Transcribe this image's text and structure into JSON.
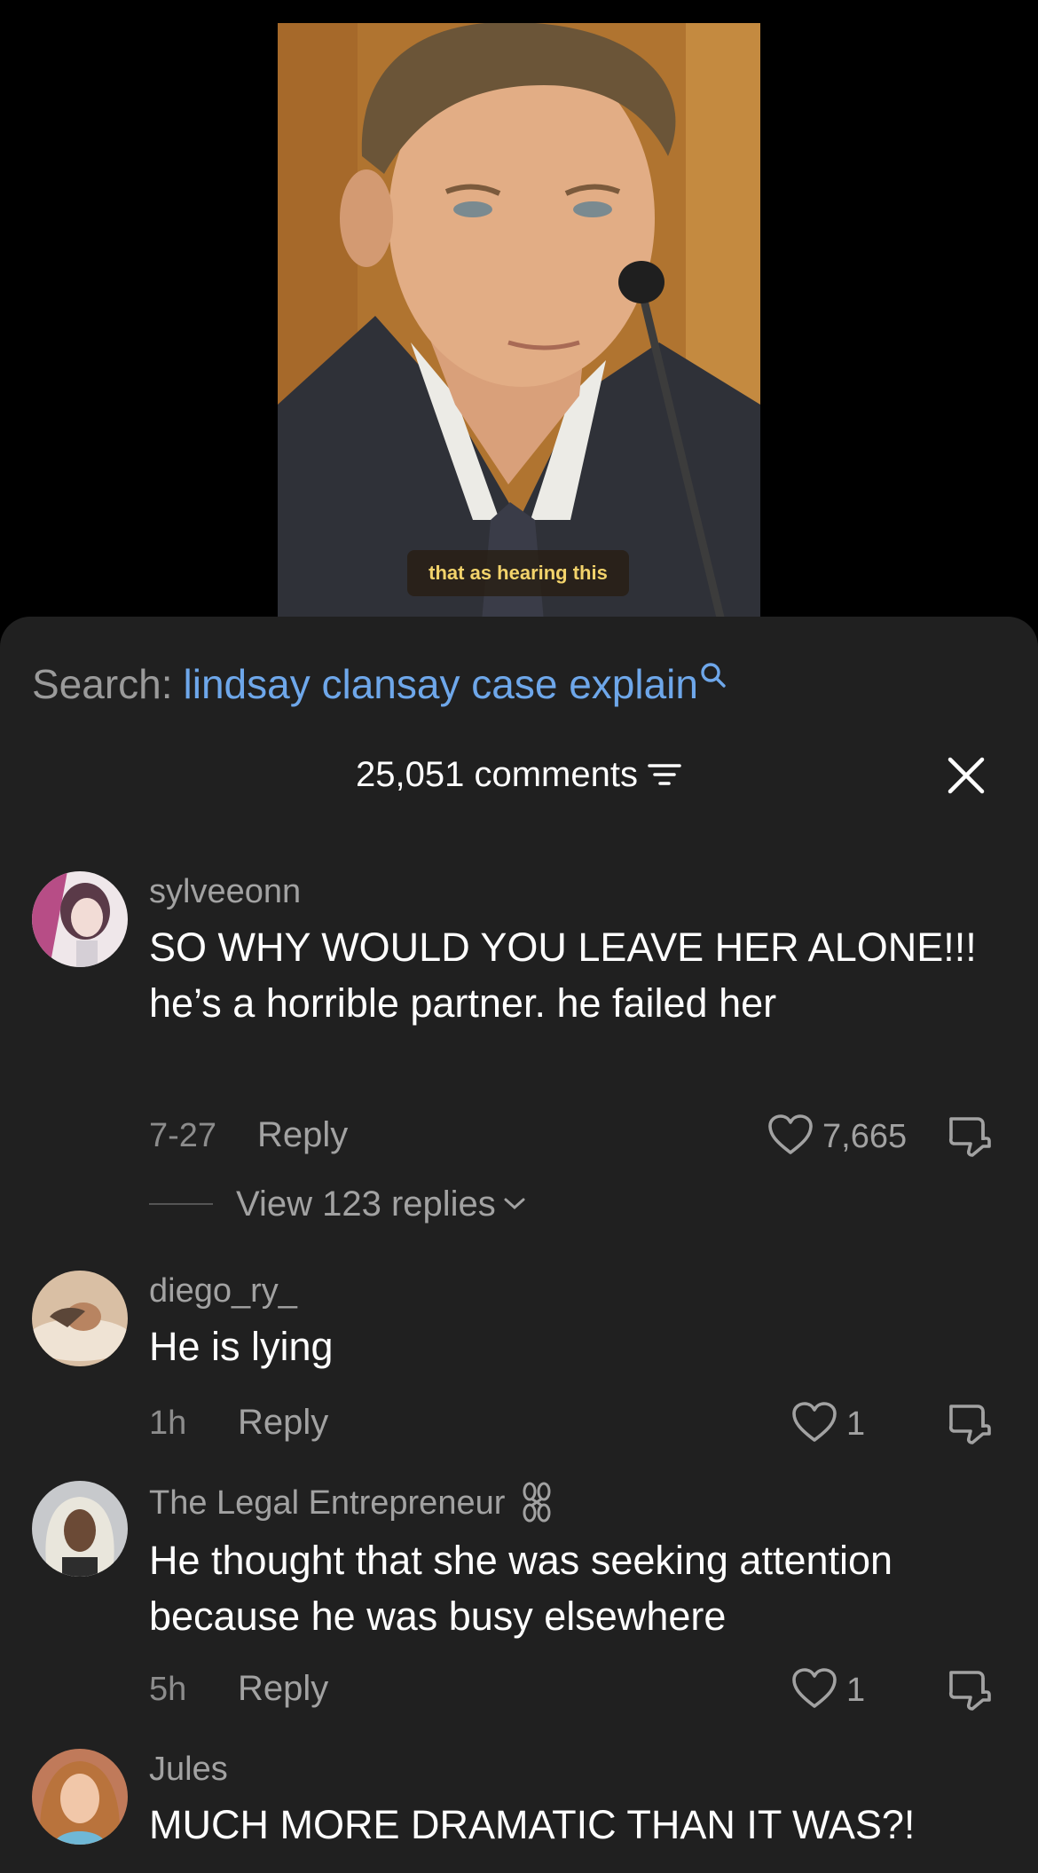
{
  "video": {
    "caption": "that as hearing this"
  },
  "search": {
    "prefix": "Search:",
    "query": "lindsay clansay case explain",
    "icon": "search-icon"
  },
  "header": {
    "count_label": "25,051 comments",
    "filter_icon": "filter-icon",
    "close_icon": "close-icon"
  },
  "comments": [
    {
      "username": "sylveeonn",
      "text": "SO WHY WOULD YOU LEAVE HER ALONE!!! he’s a horrible partner. he failed her",
      "time": "7-27",
      "reply": "Reply",
      "likes": "7,665",
      "view_replies": "View 123 replies"
    },
    {
      "username": "diego_ry_",
      "text": "He is lying",
      "time": "1h",
      "reply": "Reply",
      "likes": "1"
    },
    {
      "username": "The Legal Entrepreneur",
      "username_badge": "⛓",
      "text": "He thought that she was seeking attention because he was busy elsewhere",
      "time": "5h",
      "reply": "Reply",
      "likes": "1"
    },
    {
      "username": "Jules",
      "text": "MUCH MORE DRAMATIC THAN IT WAS?!"
    }
  ],
  "colors": {
    "sheet_bg": "#202020",
    "search_link": "#6ea7ea",
    "muted_text": "#a2a2a2",
    "caption_text": "#f3d36b"
  }
}
